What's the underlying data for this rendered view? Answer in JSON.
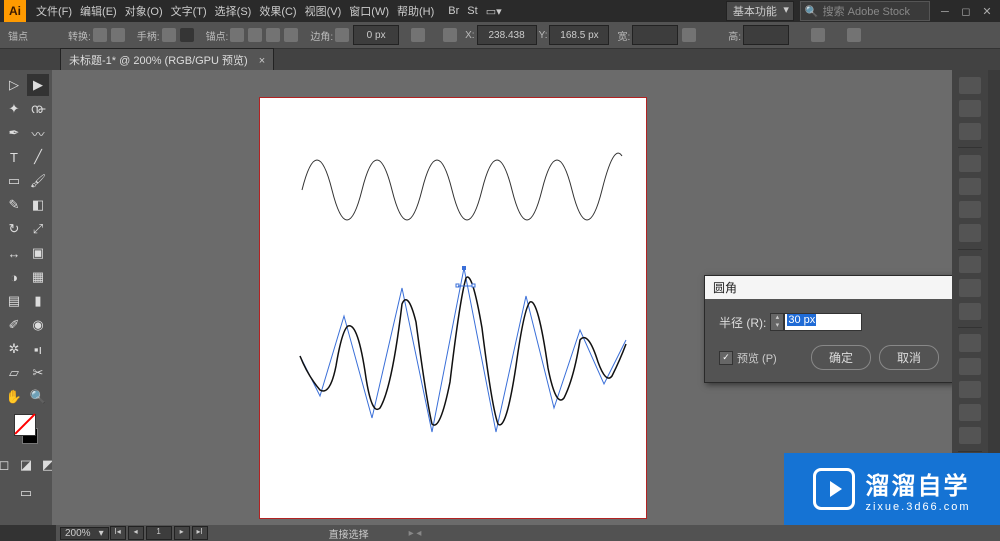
{
  "menu": {
    "file": "文件(F)",
    "edit": "编辑(E)",
    "object": "对象(O)",
    "type": "文字(T)",
    "select": "选择(S)",
    "effect": "效果(C)",
    "view": "视图(V)",
    "window": "窗口(W)",
    "help": "帮助(H)"
  },
  "workspace": "基本功能",
  "search_placeholder": "搜索 Adobe Stock",
  "control": {
    "anchor_lbl": "锚点",
    "convert_lbl": "转换:",
    "handle_lbl": "手柄:",
    "anchors_lbl": "锚点:",
    "corner_lbl": "边角:",
    "corner_val": "0 px",
    "x_lbl": "X:",
    "x_val": "238.438",
    "y_lbl": "Y:",
    "y_val": "168.5 px",
    "w_lbl": "宽:",
    "h_lbl": "高:"
  },
  "tab_title": "未标题-1* @ 200% (RGB/GPU 预览)",
  "dialog": {
    "title": "圆角",
    "radius_lbl": "半径 (R):",
    "radius_val": "30 px",
    "preview": "预览 (P)",
    "ok": "确定",
    "cancel": "取消"
  },
  "status": {
    "zoom": "200%",
    "page": "1",
    "tool": "直接选择"
  },
  "watermark": {
    "big": "溜溜自学",
    "small": "zixue.3d66.com"
  }
}
